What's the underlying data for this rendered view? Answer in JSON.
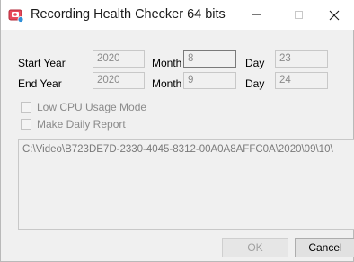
{
  "window": {
    "title": "Recording Health Checker 64 bits",
    "minimize_glyph": "—",
    "close_glyph": "✕",
    "icon": "app-icon"
  },
  "start": {
    "label": "Start Year",
    "year": "2020",
    "month_label": "Month",
    "month": "8",
    "day_label": "Day",
    "day": "23"
  },
  "end": {
    "label": "End Year",
    "year": "2020",
    "month_label": "Month",
    "month": "9",
    "day_label": "Day",
    "day": "24"
  },
  "options": {
    "low_cpu": "Low CPU Usage Mode",
    "daily_report": "Make Daily Report"
  },
  "path": "C:\\Video\\B723DE7D-2330-4045-8312-00A0A8AFFC0A\\2020\\09\\10\\",
  "buttons": {
    "ok": "OK",
    "cancel": "Cancel"
  }
}
